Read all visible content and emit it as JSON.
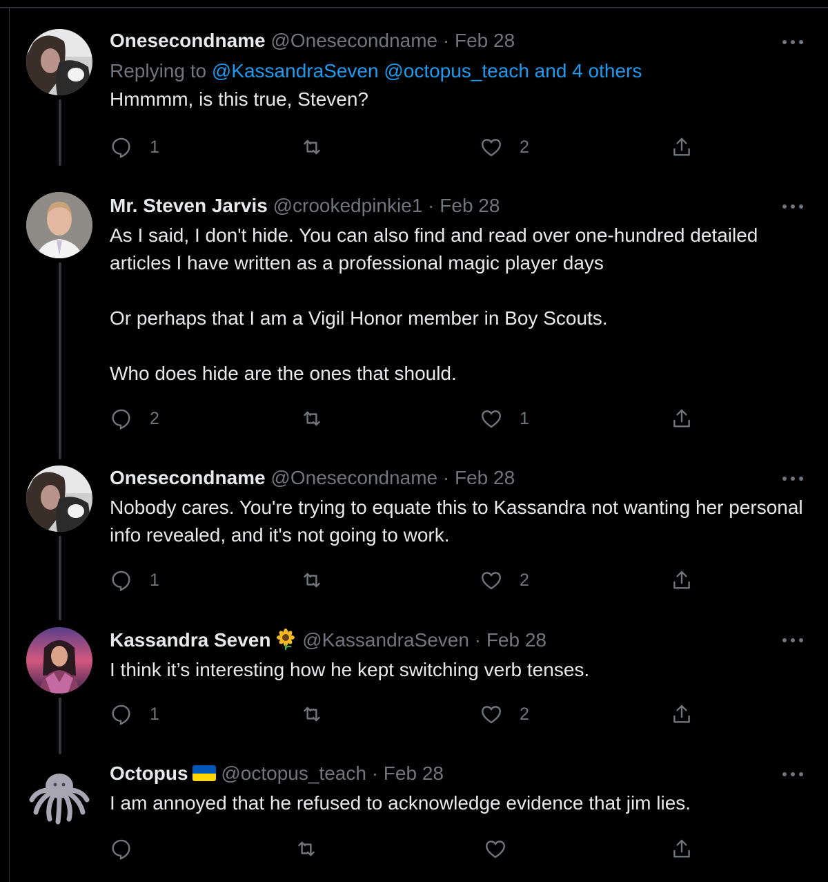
{
  "tweets": [
    {
      "name": "Onesecondname",
      "handle": "@Onesecondname",
      "date": "Feb 28",
      "replying_prefix": "Replying to ",
      "replying_links": "@KassandraSeven @octopus_teach and 4 others",
      "text": [
        "Hmmmm, is this true, Steven?"
      ],
      "replies": "1",
      "retweets": "",
      "likes": "2",
      "avatar": "woman-with-cat-avatar"
    },
    {
      "name": "Mr. Steven Jarvis",
      "handle": "@crookedpinkie1",
      "date": "Feb 28",
      "text": [
        "As I said, I don't hide. You can also find and read over one-hundred detailed articles I have written as a professional magic player days",
        "Or perhaps that I am a Vigil Honor member in Boy Scouts.",
        "Who does hide are the ones that should."
      ],
      "replies": "2",
      "retweets": "",
      "likes": "1",
      "avatar": "man-portrait-avatar"
    },
    {
      "name": "Onesecondname",
      "handle": "@Onesecondname",
      "date": "Feb 28",
      "text": [
        "Nobody cares. You're trying to equate this to Kassandra not wanting her personal info revealed, and it's not going to work."
      ],
      "replies": "1",
      "retweets": "",
      "likes": "2",
      "avatar": "woman-with-cat-avatar"
    },
    {
      "name": "Kassandra Seven",
      "handle": "@KassandraSeven",
      "date": "Feb 28",
      "text": [
        "I think it’s interesting how he kept switching verb tenses."
      ],
      "replies": "1",
      "retweets": "",
      "likes": "2",
      "avatar": "fantasy-warrior-avatar",
      "badge": "sunflower-emoji"
    },
    {
      "name": "Octopus",
      "handle": "@octopus_teach",
      "date": "Feb 28",
      "text": [
        "I am annoyed that he refused to acknowledge evidence that jim lies."
      ],
      "replies": "",
      "retweets": "",
      "likes": "",
      "avatar": "octopus-avatar",
      "badge": "ukraine-flag-emoji"
    }
  ],
  "separator": "·",
  "colors": {
    "background": "#000000",
    "text": "#e7e9ea",
    "secondary": "#71767b",
    "link": "#1d9bf0",
    "thread_line": "#333639"
  }
}
